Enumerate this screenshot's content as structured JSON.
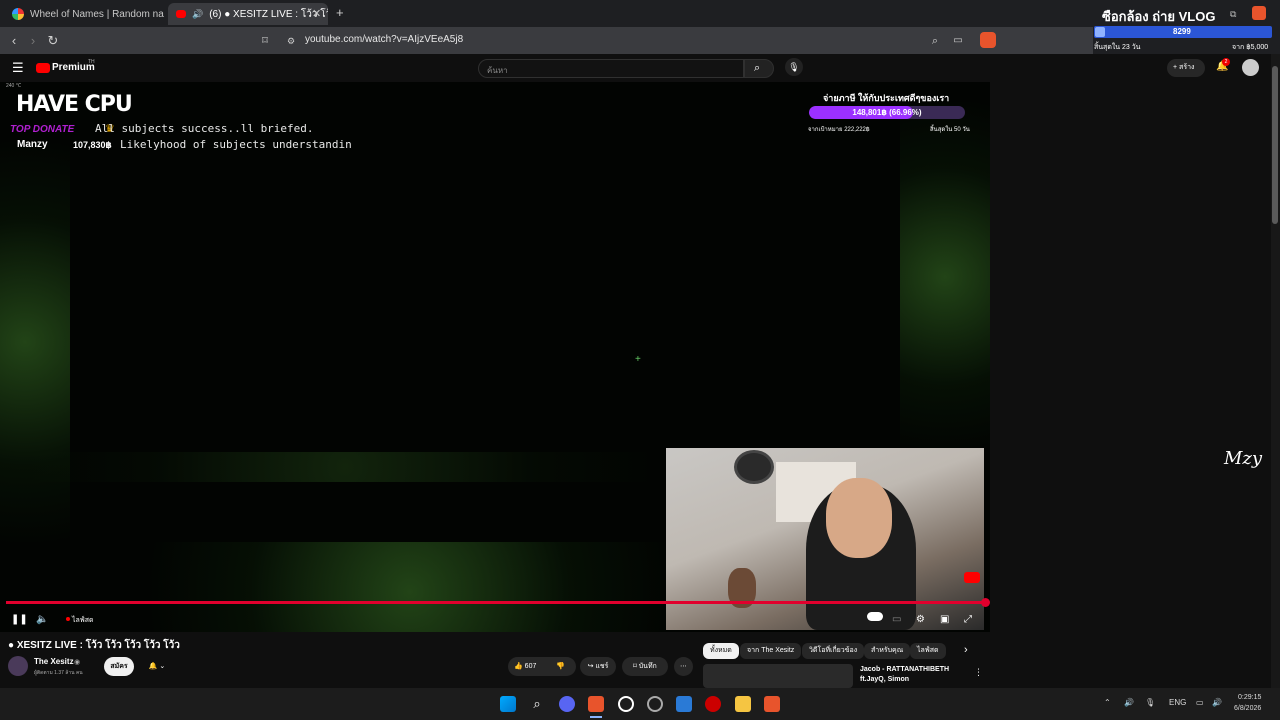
{
  "tabs": [
    {
      "title": "Wheel of Names | Random name pic"
    },
    {
      "title": "(6) ● XESITZ LIVE : โว้ว โว้ว โว้ว"
    }
  ],
  "browser": {
    "url": "youtube.com/watch?v=AIjzVEeA5j8"
  },
  "donation_overlay": {
    "title": "ซือกล้อง ถ่าย VLOG",
    "amount": "8299",
    "left_label": "สิ้นสุดใน 23 วัน",
    "right_label": "จาก ฿5,000"
  },
  "youtube": {
    "brand": "Premium",
    "brand_region": "TH",
    "search_placeholder": "ค้นหา",
    "create_label": "สร้าง",
    "notification_count": "2"
  },
  "stream_overlay": {
    "logo": "HAVE CPU",
    "top_donate_label": "TOP DONATE",
    "top_donor_name": "Manzy",
    "top_donor_amount": "107,830฿",
    "subtitle_line1": "All subjects success..ll  briefed.",
    "subtitle_line2": "Likelyhood of subjects understandin",
    "goal_title": "จ่ายภาษี ให้กับประเทศดีๆของเรา",
    "goal_bar_text": "148,801฿ (66.96%)",
    "goal_bar_progress": 0.6696,
    "goal_target": "จากเป้าหมาย 222,222฿",
    "goal_remaining": "สิ้นสุดใน 50 วัน",
    "small_badge": "240 ℃"
  },
  "player": {
    "live_label": "ไลฟ์สด",
    "progress": 1.0
  },
  "video": {
    "title": "● XESITZ LIVE : โว้ว โว้ว โว้ว โว้ว โว้ว",
    "channel_name": "The Xesitz",
    "subscribers": "ผู้ติดตาม 1.37 ล้าน คน",
    "subscribe_label": "สมัคร",
    "like_count": "607",
    "share_label": "แชร์",
    "save_label": "บันทึก"
  },
  "chips": [
    {
      "label": "ทั้งหมด",
      "active": true
    },
    {
      "label": "จาก The Xesitz",
      "active": false
    },
    {
      "label": "วิดีโอที่เกี่ยวข้อง",
      "active": false
    },
    {
      "label": "สำหรับคุณ",
      "active": false
    },
    {
      "label": "ไลฟ์สด",
      "active": false
    }
  ],
  "recommended": {
    "title_line1": "Jacob - RATTANATHIBETH",
    "title_line2": "ft.JayQ, Simon"
  },
  "watermark": "Mzy",
  "taskbar": {
    "language": "ENG",
    "time": "0:29:15",
    "date": "6/8/2026"
  },
  "colors": {
    "youtube_red": "#ff0000",
    "progress_red": "#e1002d",
    "goal_purple": "#9b30ff",
    "donate_purple": "#b020d0"
  }
}
